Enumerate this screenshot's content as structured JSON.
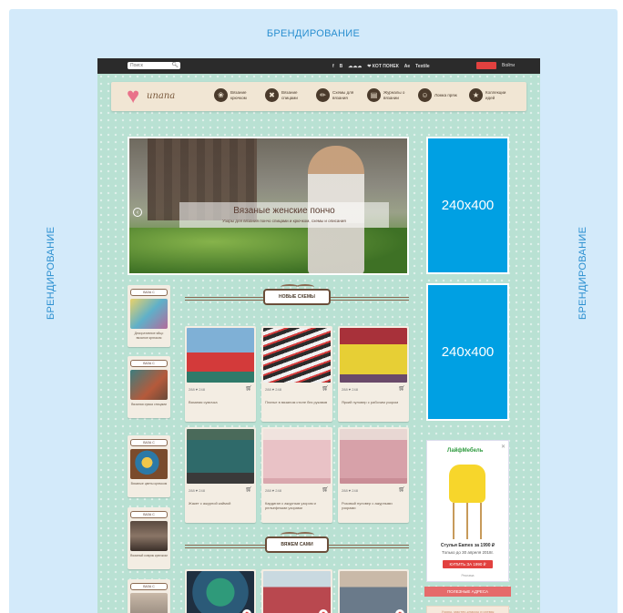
{
  "branding": {
    "top": "БРЕНДИРОВАНИЕ",
    "left": "БРЕНДИРОВАНИЕ",
    "right": "БРЕНДИРОВАНИЕ"
  },
  "topbar": {
    "search_placeholder": "Поиск",
    "links": [
      "f",
      "B",
      "☁☁☁",
      "❤ КОТ ПОНЕК",
      "Ae",
      "Textile"
    ],
    "button": "",
    "login": "Войти"
  },
  "navbar": {
    "logo": "unana",
    "items": [
      {
        "icon": "❀",
        "label": "Вязание крючком"
      },
      {
        "icon": "✖",
        "label": "Вязание спицами"
      },
      {
        "icon": "✏",
        "label": "Схемы для вязания"
      },
      {
        "icon": "▤",
        "label": "Журналы о вязании"
      },
      {
        "icon": "☺",
        "label": "Ломка пряж"
      },
      {
        "icon": "★",
        "label": "Коллекции идей"
      }
    ]
  },
  "slider": {
    "title": "Вязаные женские пончо",
    "subtitle": "Узоры для вязания пончо спицами и крючком, схемы и описания"
  },
  "ads": {
    "ad1": "240x400",
    "ad2": "240x400",
    "ad3_brand": "ЛайфМебель",
    "ad3_line1": "Стулья Eames за 1990 ₽",
    "ad3_line2": "Только до 30 апреля 2018г.",
    "ad3_button": "КУПИТЬ ЗА 1990 ₽",
    "ad3_foot": "Реклама",
    "usable": "ПОЛЕЗНЫЕ АДРЕСА",
    "small": "Узоры, мастер-классы и схемы"
  },
  "sidebar_cards": [
    {
      "label": "ВАЗА С",
      "text": "Декоративное яйцо вязаное крючком"
    },
    {
      "label": "ВАЗА С",
      "text": "Вязаная сумка спицами"
    },
    {
      "label": "ВАЗА С",
      "text": "Вязаные цветы крючком"
    },
    {
      "label": "ВАЗА С",
      "text": "Вязаный коврик крючком"
    },
    {
      "label": "ВАЗА С",
      "text": ""
    }
  ],
  "sections": {
    "new_schemes": "НОВЫЕ СХЕМЫ",
    "knit_yourself": "ВЯЖЕМ САМИ"
  },
  "cards_row1": [
    {
      "meta": "288  ♥ 248",
      "title": "Вязаная сумочка"
    },
    {
      "meta": "288  ♥ 248",
      "title": "Платье в вязаном стиле без рукавов"
    },
    {
      "meta": "288  ♥ 248",
      "title": "Яркий пуловер с рабочим узором"
    }
  ],
  "cards_row2": [
    {
      "meta": "288  ♥ 248",
      "title": "Жакет с ажурной каймой"
    },
    {
      "meta": "288  ♥ 248",
      "title": "Кардиган с ажурным узором и рельефными узорами"
    },
    {
      "meta": "288  ♥ 248",
      "title": "Розовый пуловер с ажурными узорами"
    }
  ],
  "colors": {
    "accent_blue": "#00a0e3",
    "brand_text": "#2a8fd0",
    "site_bg": "#b9e1d3",
    "topbar": "#2b2b2b",
    "red": "#e2413f"
  }
}
